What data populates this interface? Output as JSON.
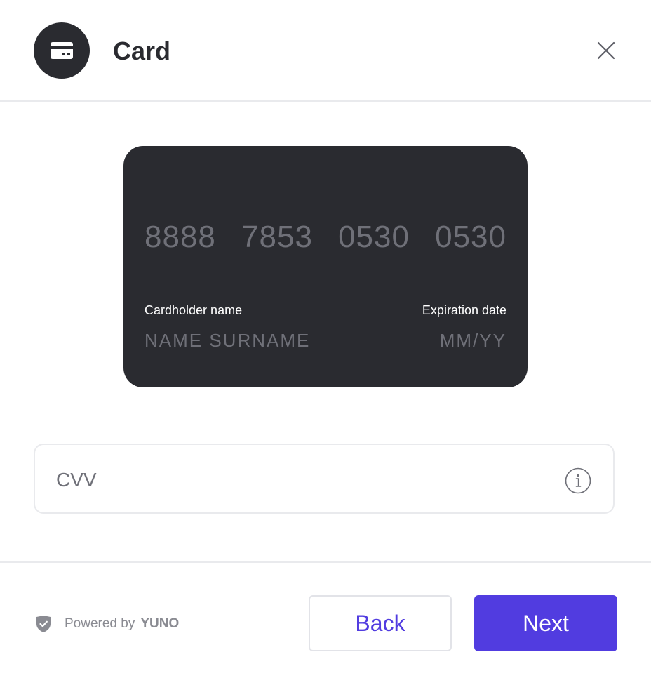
{
  "header": {
    "title": "Card",
    "icon": "credit-card-icon",
    "close_icon": "close-icon"
  },
  "card": {
    "number_groups": [
      "8888",
      "7853",
      "0530",
      "0530"
    ],
    "holder_label": "Cardholder name",
    "holder_value": "NAME SURNAME",
    "expiry_label": "Expiration date",
    "expiry_value": "MM/YY",
    "background_color": "#2a2b30"
  },
  "cvv": {
    "placeholder": "CVV",
    "value": "",
    "info_icon": "info-icon"
  },
  "footer": {
    "powered_by": "Powered by",
    "brand": "YUNO",
    "shield_icon": "shield-check-icon",
    "back_label": "Back",
    "next_label": "Next"
  },
  "colors": {
    "accent": "#513ce0",
    "dark": "#2a2b30",
    "muted": "#6f7078"
  }
}
